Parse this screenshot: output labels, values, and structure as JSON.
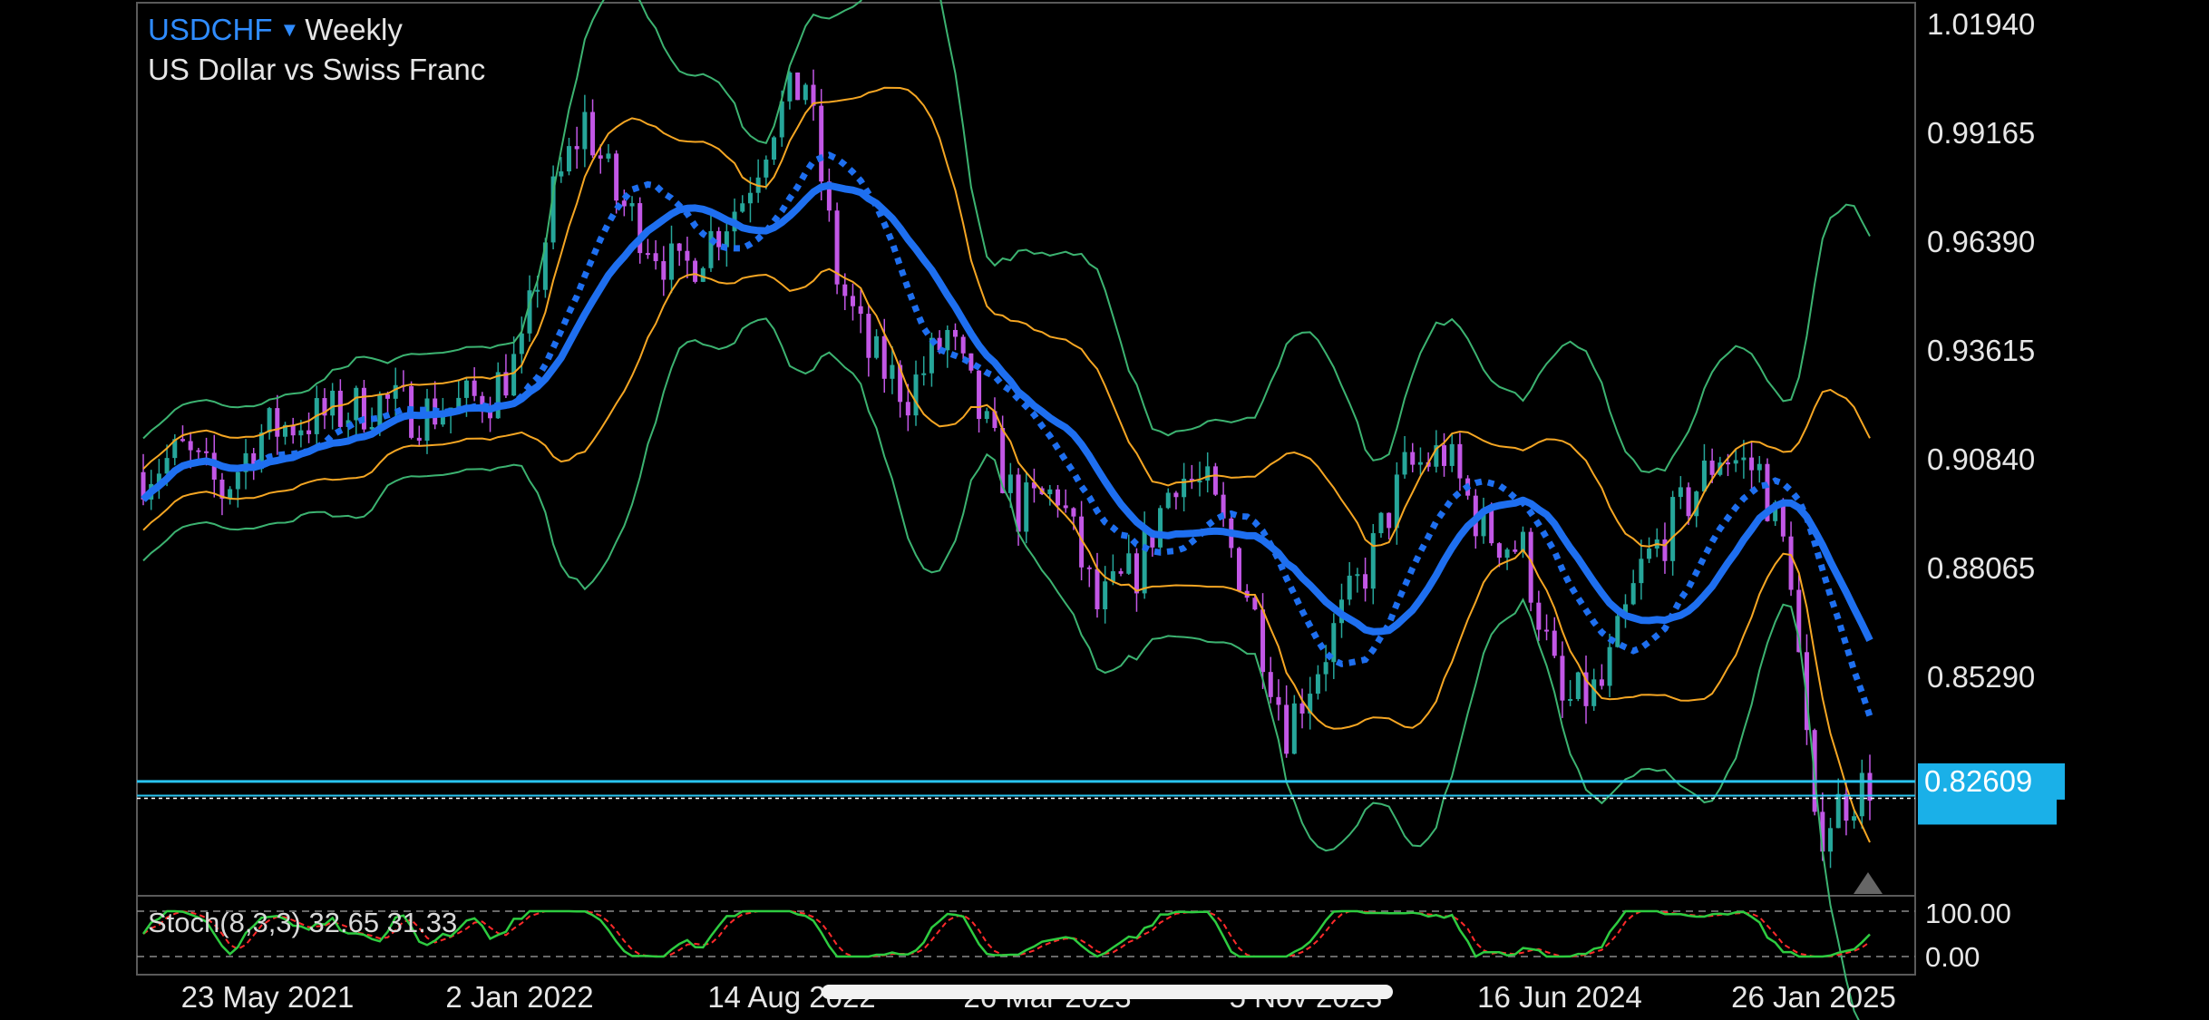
{
  "header": {
    "symbol": "USDCHF",
    "dropdown_icon": "triangle-down-icon",
    "timeframe": "Weekly",
    "description": "US Dollar vs Swiss Franc"
  },
  "indicator": {
    "label": "Stoch(8,3,3) 32.65 31.33"
  },
  "chart_data": {
    "type": "candlestick",
    "symbol": "USDCHF",
    "timeframe": "Weekly",
    "price_axis": {
      "ticks": [
        "1.01940",
        "0.99165",
        "0.96390",
        "0.93615",
        "0.90840",
        "0.88065",
        "0.85290"
      ],
      "range": [
        0.7935,
        1.0194
      ]
    },
    "current_price": {
      "label": "0.82609",
      "value": 0.82609
    },
    "second_level": {
      "value": 0.8225
    },
    "x_axis": {
      "labels": [
        "23 May 2021",
        "2 Jan 2022",
        "14 Aug 2022",
        "26 Mar 2023",
        "5 Nov 2023",
        "16 Jun 2024",
        "26 Jan 2025"
      ]
    },
    "price_trend": [
      [
        "2021-03-14",
        0.905
      ],
      [
        "2021-04-18",
        0.91
      ],
      [
        "2021-05-23",
        0.9
      ],
      [
        "2021-06-27",
        0.915
      ],
      [
        "2021-08-01",
        0.918
      ],
      [
        "2021-09-05",
        0.92
      ],
      [
        "2021-10-10",
        0.923
      ],
      [
        "2021-11-14",
        0.92
      ],
      [
        "2021-12-19",
        0.922
      ],
      [
        "2022-01-16",
        0.925
      ],
      [
        "2022-02-13",
        0.935
      ],
      [
        "2022-03-13",
        0.975
      ],
      [
        "2022-04-10",
        0.995
      ],
      [
        "2022-05-08",
        0.975
      ],
      [
        "2022-06-05",
        0.965
      ],
      [
        "2022-07-03",
        0.955
      ],
      [
        "2022-07-31",
        0.965
      ],
      [
        "2022-08-28",
        0.975
      ],
      [
        "2022-09-25",
        0.995
      ],
      [
        "2022-10-23",
        1.005
      ],
      [
        "2022-11-20",
        0.955
      ],
      [
        "2022-12-18",
        0.935
      ],
      [
        "2023-01-22",
        0.925
      ],
      [
        "2023-02-26",
        0.94
      ],
      [
        "2023-03-26",
        0.92
      ],
      [
        "2023-04-30",
        0.895
      ],
      [
        "2023-06-04",
        0.9
      ],
      [
        "2023-07-09",
        0.87
      ],
      [
        "2023-08-13",
        0.88
      ],
      [
        "2023-09-17",
        0.905
      ],
      [
        "2023-10-15",
        0.9
      ],
      [
        "2023-11-19",
        0.875
      ],
      [
        "2023-12-24",
        0.84
      ],
      [
        "2024-01-28",
        0.86
      ],
      [
        "2024-03-03",
        0.88
      ],
      [
        "2024-04-07",
        0.905
      ],
      [
        "2024-05-12",
        0.91
      ],
      [
        "2024-06-16",
        0.89
      ],
      [
        "2024-07-21",
        0.885
      ],
      [
        "2024-08-25",
        0.845
      ],
      [
        "2024-09-29",
        0.85
      ],
      [
        "2024-11-03",
        0.88
      ],
      [
        "2024-12-08",
        0.895
      ],
      [
        "2025-01-12",
        0.91
      ],
      [
        "2025-02-16",
        0.905
      ],
      [
        "2025-03-16",
        0.88
      ],
      [
        "2025-04-06",
        0.812
      ],
      [
        "2025-04-27",
        0.82
      ],
      [
        "2025-05-25",
        0.826
      ]
    ],
    "indicators": {
      "moving_averages": [
        "solid",
        "dotted"
      ],
      "bollinger_bands": [
        "inner",
        "outer"
      ],
      "stochastic": {
        "params": "8,3,3",
        "k": 32.65,
        "d": 31.33,
        "levels": [
          "100.00",
          "0.00"
        ]
      }
    },
    "colors": {
      "bull": "#26a69a",
      "bear": "#c257e6",
      "ma": "#1e6ff0",
      "inner_band": "#f5a623",
      "outer_band": "#3cb371",
      "level_line": "#29c4f0",
      "price_tag": "#1ab0e8",
      "stoch_k": "#2ecc40",
      "stoch_d": "#ff2a2a"
    }
  }
}
